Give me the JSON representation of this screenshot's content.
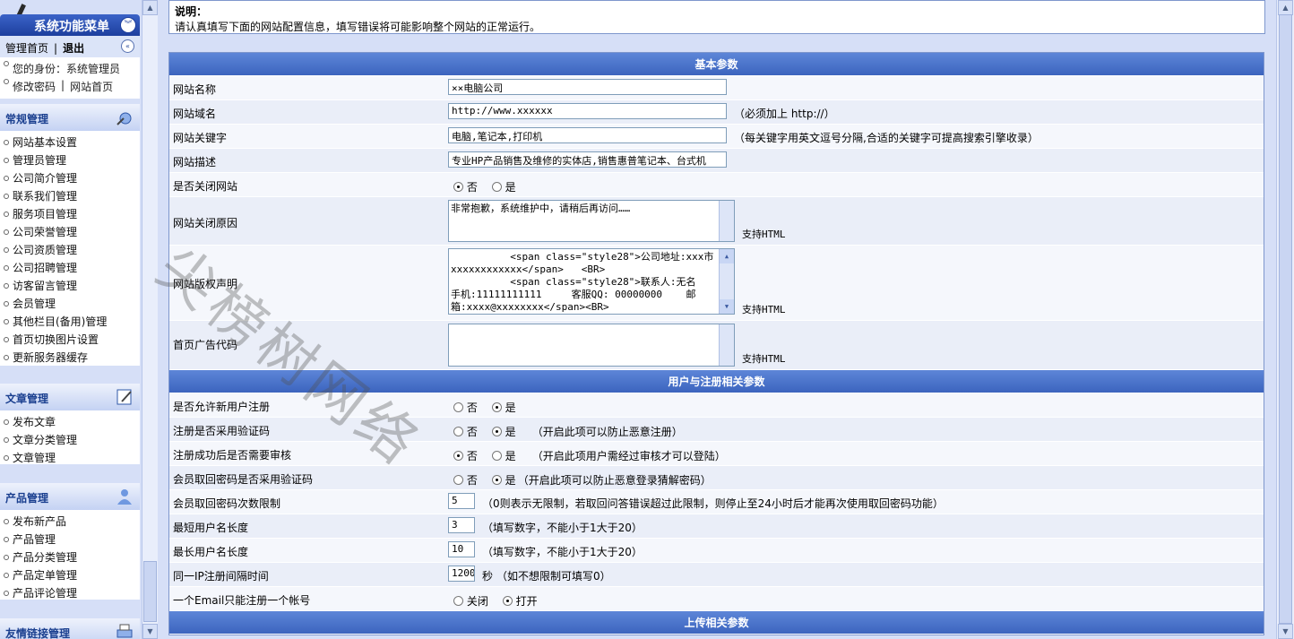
{
  "sidebar": {
    "menu_title": "系统功能菜单",
    "home_link": "管理首页",
    "separator": "|",
    "logout_link": "退出",
    "identity": "您的身份：系统管理员",
    "change_password": "修改密码",
    "site_home": "网站首页",
    "sections": [
      {
        "title": "常规管理",
        "icon": "gear-wrench-icon",
        "items": [
          "网站基本设置",
          "管理员管理",
          "公司简介管理",
          "联系我们管理",
          "服务项目管理",
          "公司荣誉管理",
          "公司资质管理",
          "公司招聘管理",
          "访客留言管理",
          "会员管理",
          "其他栏目(备用)管理",
          "首页切换图片设置",
          "更新服务器缓存"
        ]
      },
      {
        "title": "文章管理",
        "icon": "pencil-doc-icon",
        "items": [
          "发布文章",
          "文章分类管理",
          "文章管理"
        ]
      },
      {
        "title": "产品管理",
        "icon": "user-star-icon",
        "items": [
          "发布新产品",
          "产品管理",
          "产品分类管理",
          "产品定单管理",
          "产品评论管理"
        ]
      },
      {
        "title": "友情链接管理",
        "icon": "printer-icon",
        "items": []
      }
    ]
  },
  "note": {
    "title": "说明：",
    "text": "请认真填写下面的网站配置信息，填写错误将可能影响整个网站的正常运行。"
  },
  "basic": {
    "header": "基本参数",
    "site_name_label": "网站名称",
    "site_name_value": "××电脑公司",
    "domain_label": "网站域名",
    "domain_value": "http://www.xxxxxx",
    "domain_hint": "（必须加上 http://）",
    "keywords_label": "网站关键字",
    "keywords_value": "电脑,笔记本,打印机",
    "keywords_hint": "（每关键字用英文逗号分隔,合适的关键字可提高搜索引擎收录）",
    "desc_label": "网站描述",
    "desc_value": "专业HP产品销售及维修的实体店,销售惠普笔记本、台式机",
    "close_label": "是否关闭网站",
    "opt_no": "否",
    "opt_yes": "是",
    "close_reason_label": "网站关闭原因",
    "close_reason_value": "非常抱歉，系统维护中，请稍后再访问……",
    "support_html": "支持HTML",
    "copyright_label": "网站版权声明",
    "copyright_value": "          <span class=\"style28\">公司地址:xxx市xxxxxxxxxxxx</span>   <BR>\n          <span class=\"style28\">联系人:无名\n手机:11111111111     客服QQ: 00000000    邮箱:xxxx@xxxxxxxx</span><BR>",
    "ad_label": "首页广告代码",
    "ad_value": ""
  },
  "user": {
    "header": "用户与注册相关参数",
    "allow_reg_label": "是否允许新用户注册",
    "reg_captcha_label": "注册是否采用验证码",
    "reg_captcha_hint": "（开启此项可以防止恶意注册）",
    "reg_audit_label": "注册成功后是否需要审核",
    "reg_audit_hint": "（开启此项用户需经过审核才可以登陆）",
    "pwd_captcha_label": "会员取回密码是否采用验证码",
    "pwd_captcha_hint": "（开启此项可以防止恶意登录猜解密码）",
    "pwd_limit_label": "会员取回密码次数限制",
    "pwd_limit_value": "5",
    "pwd_limit_hint": "（0则表示无限制，若取回问答错误超过此限制，则停止至24小时后才能再次使用取回密码功能）",
    "min_len_label": "最短用户名长度",
    "min_len_value": "3",
    "min_len_hint": "（填写数字，不能小于1大于20）",
    "max_len_label": "最长用户名长度",
    "max_len_value": "10",
    "max_len_hint": "（填写数字，不能小于1大于20）",
    "ip_interval_label": "同一IP注册间隔时间",
    "ip_interval_value": "1200",
    "ip_interval_unit": "秒",
    "ip_interval_hint": "（如不想限制可填写0）",
    "email_once_label": "一个Email只能注册一个帐号",
    "opt_close": "关闭",
    "opt_open": "打开"
  },
  "upload": {
    "header": "上传相关参数"
  },
  "watermark": "尖榜树网络"
}
